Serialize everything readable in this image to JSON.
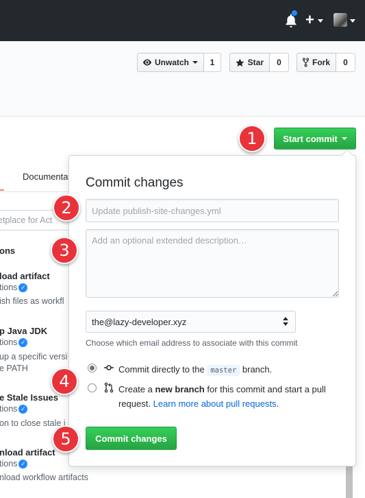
{
  "header": {
    "bell_icon": "bell-icon",
    "plus_label": "+",
    "avatar_icon": "avatar"
  },
  "repo_actions": {
    "watch_label": "Unwatch",
    "watch_count": "1",
    "star_label": "Star",
    "star_count": "0",
    "fork_label": "Fork",
    "fork_count": "0"
  },
  "start_commit": {
    "label": "Start commit"
  },
  "background": {
    "tab_documentation": "Documentat",
    "search_fragment": "etplace for Act",
    "section_fragment": "ons",
    "items": [
      {
        "title": "load artifact",
        "byline": "tions",
        "desc": "ish files as workfl"
      },
      {
        "title": "p Java JDK",
        "byline": "tions",
        "desc": "up a specific versi",
        "desc2": "e PATH"
      },
      {
        "title": "e Stale Issues",
        "byline": "tions",
        "desc": "on to close stale i"
      },
      {
        "title": "nload artifact",
        "byline": "tions",
        "desc": "nload workflow artifacts"
      }
    ]
  },
  "commit_panel": {
    "title": "Commit changes",
    "summary_placeholder": "Update publish-site-changes.yml",
    "description_placeholder": "Add an optional extended description…",
    "email_selected": "the@lazy-developer.xyz",
    "email_note": "Choose which email address to associate with this commit",
    "option_direct_prefix": "Commit directly to the",
    "option_direct_branch": "master",
    "option_direct_suffix": "branch.",
    "option_new_prefix": "Create a",
    "option_new_bold": "new branch",
    "option_new_suffix": "for this commit and start a pull request.",
    "option_new_link": "Learn more about pull requests",
    "option_new_period": ".",
    "commit_button": "Commit changes"
  },
  "callouts": [
    "1",
    "2",
    "3",
    "4",
    "5"
  ],
  "colors": {
    "topbar": "#24292e",
    "primary_green": "#28a745",
    "link": "#0366d6",
    "callout_red": "#e8333a"
  }
}
